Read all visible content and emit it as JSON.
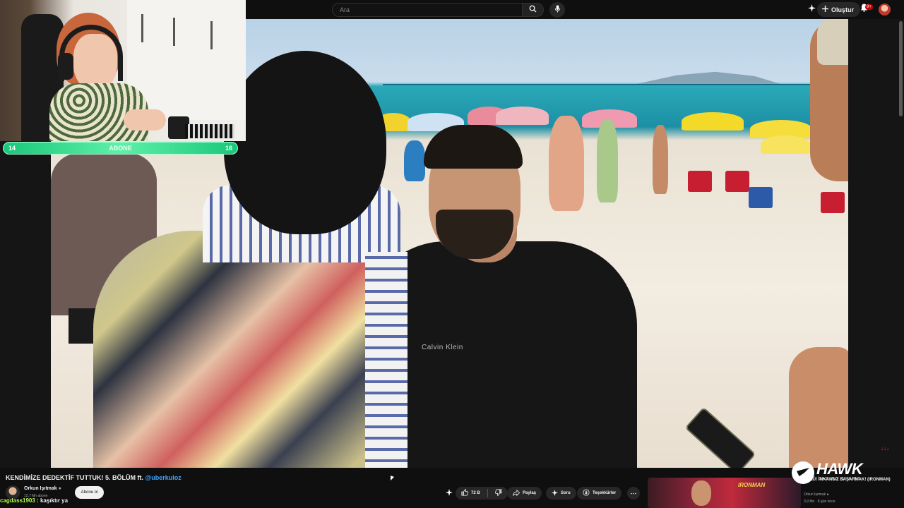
{
  "header": {
    "search_placeholder": "Ara",
    "create_label": "Oluştur",
    "notification_count": "9+"
  },
  "overlay": {
    "sub_goal": {
      "current": "14",
      "label": "ABONE",
      "target": "16"
    },
    "chat": {
      "user": "cagdass1903",
      "message": " : kaşıktır ya"
    },
    "watermark": {
      "brand": "HAWK",
      "tagline": "GAMING CHAIRS"
    }
  },
  "video": {
    "title_prefix": "KENDİMİZE DEDEKTİF TUTTUK! 5. BÖLÜM ft. ",
    "title_mention": "@uberkuloz",
    "channel_name": "Orkun Işıtmak",
    "subscriber_count": "12,7 Mn abone",
    "subscribe_label": "Abone ol",
    "shirt_text": "Calvin Klein"
  },
  "actions": {
    "likes": "72 B",
    "share": "Paylaş",
    "ask": "Soru",
    "thanks": "Teşekkürler"
  },
  "related": {
    "title": "SÜNÜ! İMKANSIZ BAŞARMAK! (IRONMAN)",
    "thumb_text": "IRONMAN",
    "channel": "Orkun Işıtmak",
    "views": "3,9 Mn",
    "age": "8 gün önce"
  }
}
